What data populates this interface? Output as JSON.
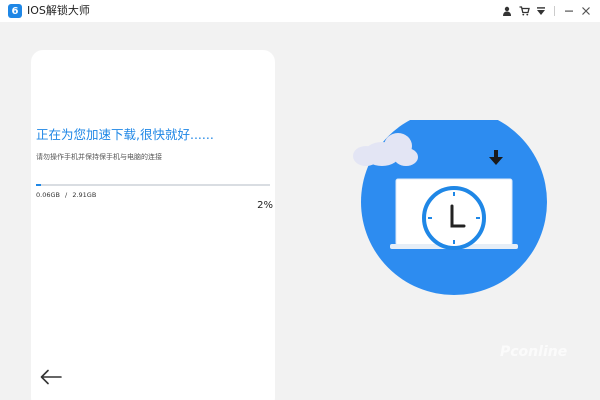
{
  "titlebar": {
    "logo_glyph": "6",
    "app_name": "IOS解锁大师",
    "controls": [
      "user-icon",
      "cart-icon",
      "menu-down-icon",
      "minimize-icon",
      "close-icon"
    ]
  },
  "progress": {
    "title": "正在为您加速下载,很快就好......",
    "subtitle": "请勿操作手机并保持保手机与电脑的连接",
    "downloaded": "0.06GB",
    "size_separator": "/",
    "total": "2.91GB",
    "percent_text": "2%",
    "fraction": 0.02
  },
  "watermark": {
    "text": "Pconline"
  },
  "colors": {
    "accent": "#1f87e6",
    "circle": "#2d8cf0",
    "panel": "#ffffff",
    "background": "#f2f2f2"
  },
  "icons": {
    "back": "arrow-left-icon",
    "illustration": "laptop-clock-download-icon",
    "cloud": "cloud-icon"
  }
}
